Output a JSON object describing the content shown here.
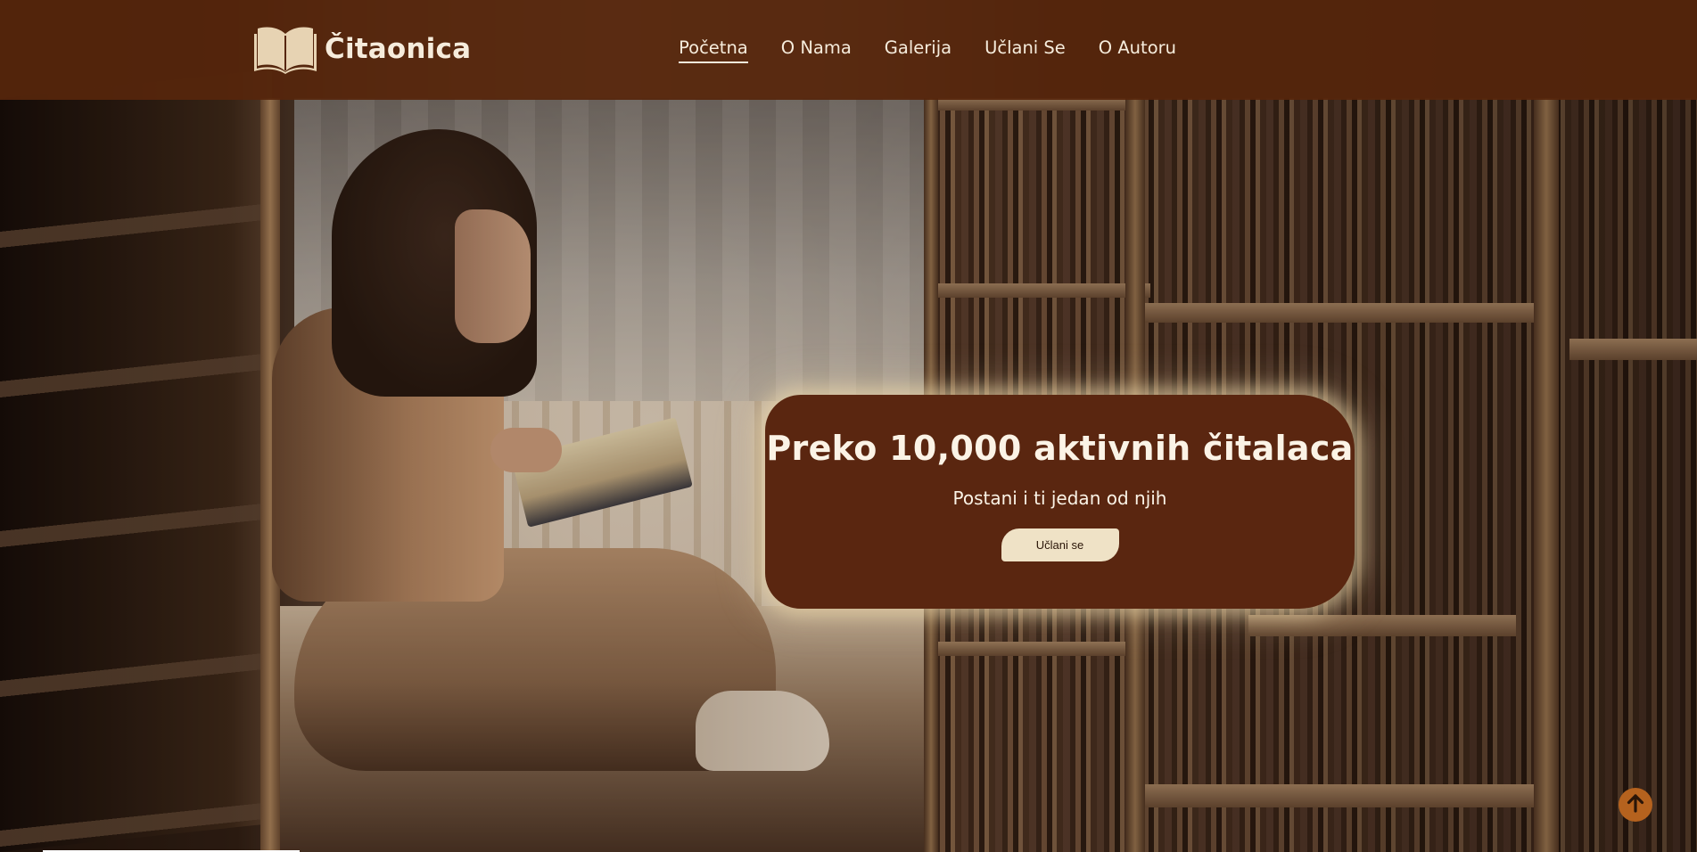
{
  "brand": {
    "name": "Čitaonica",
    "icon": "open-book-icon",
    "icon_color": "#e7d3b3"
  },
  "nav": {
    "items": [
      {
        "label": "Početna",
        "active": true
      },
      {
        "label": "O Nama",
        "active": false
      },
      {
        "label": "Galerija",
        "active": false
      },
      {
        "label": "Učlani Se",
        "active": false
      },
      {
        "label": "O Autoru",
        "active": false
      }
    ]
  },
  "hero": {
    "background": "library-reader-photo",
    "cta": {
      "title": "Preko 10,000 aktivnih čitalaca",
      "subtitle": "Postani i ti jedan od njih",
      "button_label": "Učlani se"
    }
  },
  "scroll_top": {
    "icon": "arrow-up-icon",
    "color": "#b5621e"
  },
  "colors": {
    "header_bg": "#56260c",
    "card_bg": "#5a2610",
    "text_light": "#f6ecdc",
    "button_bg": "#efe2c6"
  }
}
